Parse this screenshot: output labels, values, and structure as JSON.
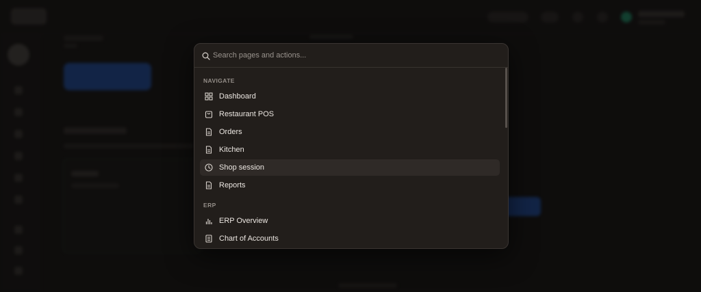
{
  "palette": {
    "search_placeholder": "Search pages and actions...",
    "sections": [
      {
        "label": "NAVIGATE",
        "items": [
          {
            "label": "Dashboard",
            "icon": "grid-icon",
            "active": false
          },
          {
            "label": "Restaurant POS",
            "icon": "shopping-bag-icon",
            "active": false
          },
          {
            "label": "Orders",
            "icon": "document-icon",
            "active": false
          },
          {
            "label": "Kitchen",
            "icon": "document-icon",
            "active": false
          },
          {
            "label": "Shop session",
            "icon": "clock-icon",
            "active": true
          },
          {
            "label": "Reports",
            "icon": "document-icon",
            "active": false
          }
        ]
      },
      {
        "label": "ERP",
        "items": [
          {
            "label": "ERP Overview",
            "icon": "bar-chart-icon",
            "active": false
          },
          {
            "label": "Chart of Accounts",
            "icon": "ledger-icon",
            "active": false
          }
        ]
      }
    ]
  },
  "colors": {
    "background": "#141211",
    "palette_bg": "#221e1b",
    "accent_blue": "#1f4fa3",
    "status_green": "#1f8f6a"
  }
}
